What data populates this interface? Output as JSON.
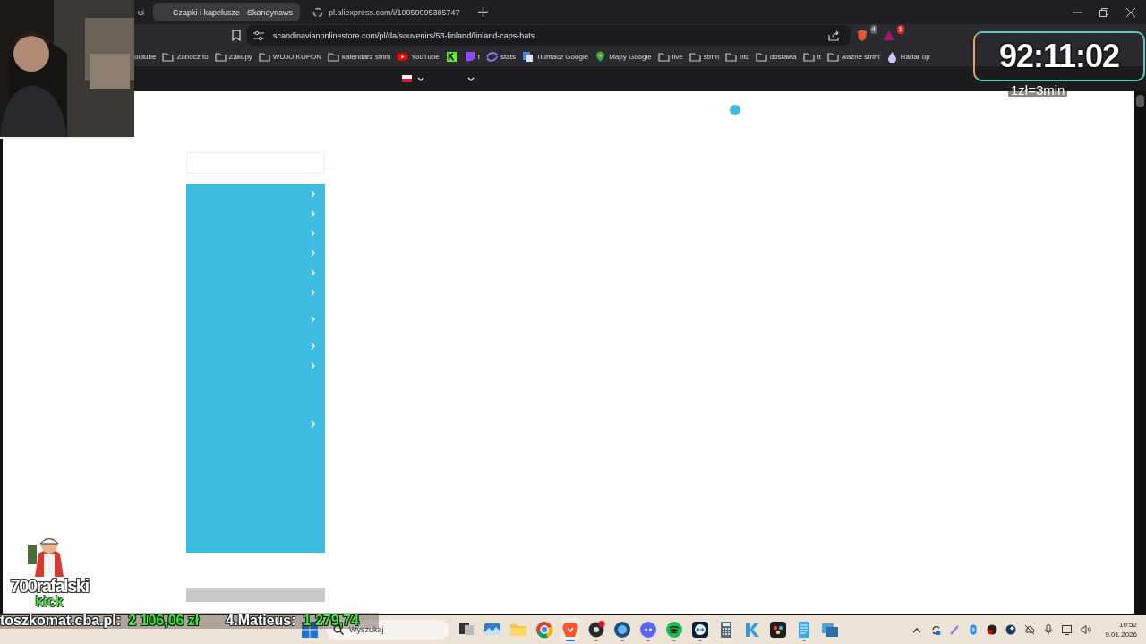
{
  "tabs": [
    {
      "label": "ui",
      "selected": false
    },
    {
      "label": "Czapki i kapelusze - Skandynaws",
      "selected": true
    },
    {
      "label": "pl.aliexpress.com/i/10050095385747",
      "selected": false
    }
  ],
  "address_bar": {
    "url": "scandinavianonlinestore.com/pl/da/souvenirs/53-finland/finland-caps-hats"
  },
  "extensions": [
    {
      "kind": "shield",
      "badge": "4"
    },
    {
      "kind": "rewards",
      "badge": "1"
    }
  ],
  "bookmarks": [
    {
      "kind": "text",
      "label": "outube"
    },
    {
      "kind": "folder",
      "label": "Zobocz to"
    },
    {
      "kind": "folder",
      "label": "Zakupy"
    },
    {
      "kind": "folder",
      "label": "WUJO KUPON"
    },
    {
      "kind": "folder",
      "label": "kalendarz strim"
    },
    {
      "kind": "youtube",
      "label": "YouTube"
    },
    {
      "kind": "kick"
    },
    {
      "kind": "twitch",
      "label": "t"
    },
    {
      "kind": "stats",
      "label": "stats"
    },
    {
      "kind": "translate",
      "label": "Tłumacz Google"
    },
    {
      "kind": "maps",
      "label": "Mapy Google"
    },
    {
      "kind": "folder",
      "label": "live"
    },
    {
      "kind": "folder",
      "label": "strim"
    },
    {
      "kind": "folder",
      "label": "btc"
    },
    {
      "kind": "folder",
      "label": "dostawa"
    },
    {
      "kind": "folder",
      "label": "tt"
    },
    {
      "kind": "folder",
      "label": "ważne strim"
    },
    {
      "kind": "radar",
      "label": "Radar op"
    }
  ],
  "sidebar": {
    "rows": [
      {
        "kind": "single"
      },
      {
        "kind": "single"
      },
      {
        "kind": "single"
      },
      {
        "kind": "single"
      },
      {
        "kind": "single"
      },
      {
        "kind": "single"
      },
      {
        "kind": "double"
      },
      {
        "kind": "single"
      },
      {
        "kind": "single"
      },
      {
        "kind": "tall"
      }
    ]
  },
  "timer_overlay": {
    "time": "92:11:02",
    "rate": "1zł=3min"
  },
  "streamer_logo": {
    "name": "700rafalski",
    "platform": "kick"
  },
  "ticker": [
    {
      "label": "toszkomat.cba.pl:",
      "amount": "2 106,06 zł"
    },
    {
      "label": "4.Matieus:",
      "amount": "1 279,74"
    }
  ],
  "taskbar": {
    "search_placeholder": "Wyszukaj",
    "apps": [
      {
        "kind": "taskview",
        "running": false,
        "selected": false
      },
      {
        "kind": "photos",
        "running": false,
        "selected": false
      },
      {
        "kind": "folder",
        "running": false,
        "selected": false
      },
      {
        "kind": "chrome",
        "running": false,
        "selected": false
      },
      {
        "kind": "brave",
        "running": true,
        "selected": true
      },
      {
        "kind": "obs",
        "running": true,
        "selected": false
      },
      {
        "kind": "disc",
        "running": true,
        "selected": false
      },
      {
        "kind": "discord",
        "running": true,
        "selected": false
      },
      {
        "kind": "spotify",
        "running": true,
        "selected": false
      },
      {
        "kind": "teamviewer",
        "running": true,
        "selected": false
      },
      {
        "kind": "calculator",
        "running": false,
        "selected": false
      },
      {
        "kind": "editor",
        "running": false,
        "selected": false
      },
      {
        "kind": "resolve",
        "running": false,
        "selected": false
      },
      {
        "kind": "notepad",
        "running": true,
        "selected": false
      },
      {
        "kind": "windows",
        "running": false,
        "selected": false
      }
    ],
    "time": "10:52",
    "date": "9.01.2026"
  }
}
